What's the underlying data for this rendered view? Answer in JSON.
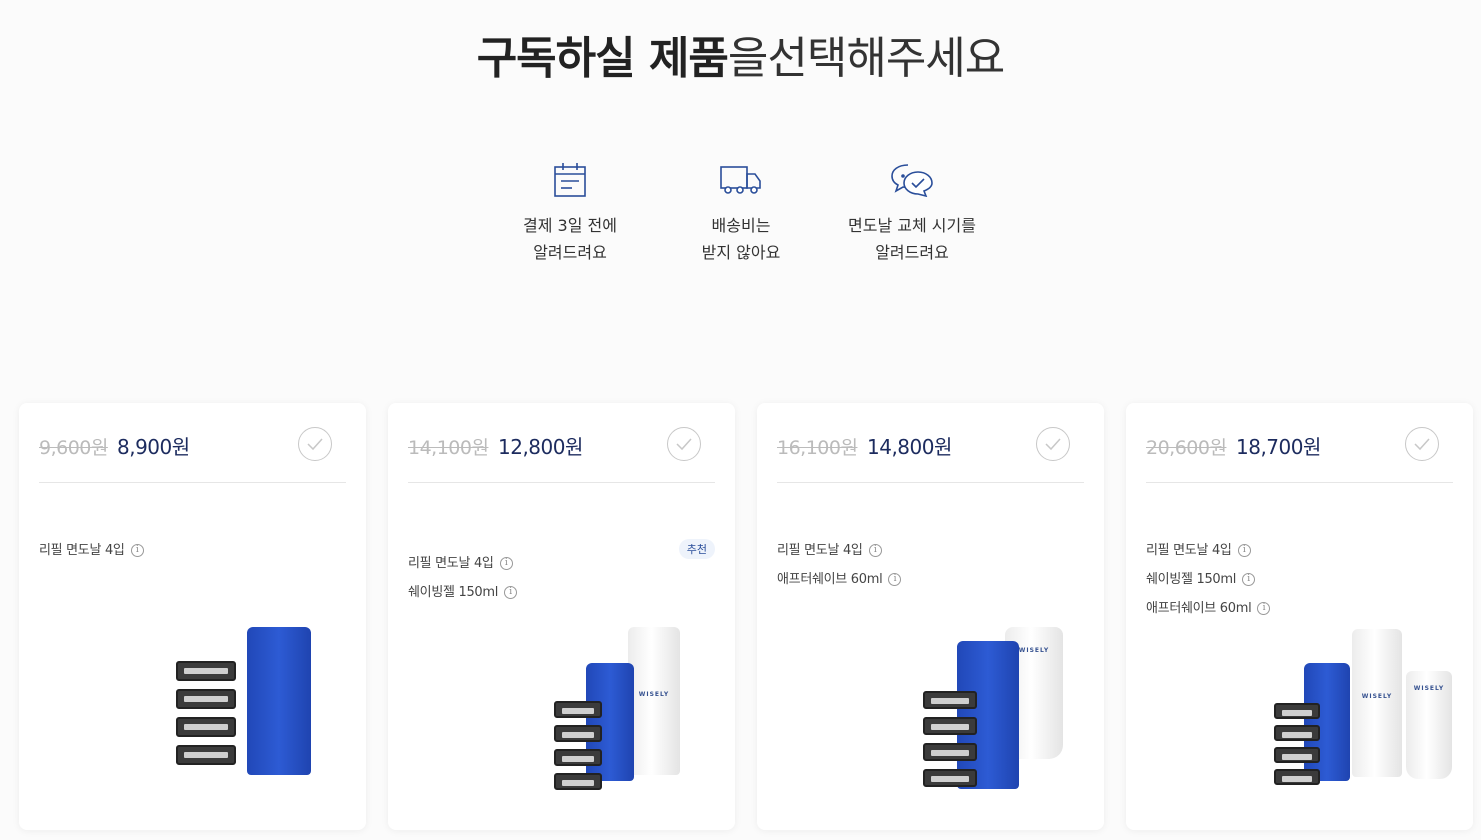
{
  "title": {
    "bold": "구독하실 제품",
    "light": "을선택해주세요"
  },
  "benefits": [
    {
      "icon": "calendar-icon",
      "line1": "결제 3일 전에",
      "line2": "알려드려요"
    },
    {
      "icon": "truck-icon",
      "line1": "배송비는",
      "line2": "받지 않아요"
    },
    {
      "icon": "chat-check-icon",
      "line1": "면도날 교체 시기를",
      "line2": "알려드려요"
    }
  ],
  "cards": [
    {
      "original_price": "9,600원",
      "price": "8,900원",
      "items": [
        "리필 면도날 4입"
      ],
      "badge": ""
    },
    {
      "original_price": "14,100원",
      "price": "12,800원",
      "items": [
        "리필 면도날 4입",
        "쉐이빙젤 150ml"
      ],
      "badge": "추천"
    },
    {
      "original_price": "16,100원",
      "price": "14,800원",
      "items": [
        "리필 면도날 4입",
        "애프터쉐이브 60ml"
      ],
      "badge": ""
    },
    {
      "original_price": "20,600원",
      "price": "18,700원",
      "items": [
        "리필 면도날 4입",
        "쉐이빙젤 150ml",
        "애프터쉐이브 60ml"
      ],
      "badge": ""
    }
  ],
  "info_glyph": "i",
  "product_brand": "WISELY",
  "colors": {
    "accent": "#2d5bd4",
    "price": "#1c2b5e",
    "icon": "#2a4e9a"
  }
}
